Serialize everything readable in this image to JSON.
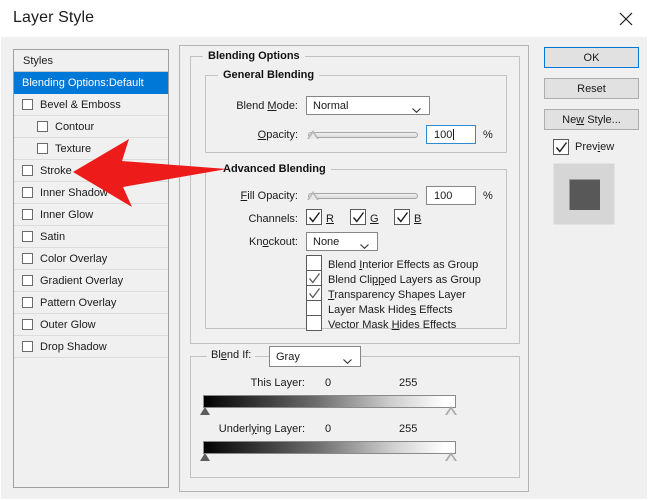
{
  "window": {
    "title": "Layer Style",
    "close_icon": "close-icon"
  },
  "styles_panel": {
    "header": "Styles",
    "items": [
      {
        "label": "Blending Options:Default",
        "selected": true,
        "checkbox": false,
        "indent": 0
      },
      {
        "label": "Bevel & Emboss",
        "selected": false,
        "checkbox": true,
        "checked": false,
        "indent": 0
      },
      {
        "label": "Contour",
        "selected": false,
        "checkbox": true,
        "checked": false,
        "indent": 1
      },
      {
        "label": "Texture",
        "selected": false,
        "checkbox": true,
        "checked": false,
        "indent": 1
      },
      {
        "label": "Stroke",
        "selected": false,
        "checkbox": true,
        "checked": false,
        "indent": 0
      },
      {
        "label": "Inner Shadow",
        "selected": false,
        "checkbox": true,
        "checked": false,
        "indent": 0
      },
      {
        "label": "Inner Glow",
        "selected": false,
        "checkbox": true,
        "checked": false,
        "indent": 0
      },
      {
        "label": "Satin",
        "selected": false,
        "checkbox": true,
        "checked": false,
        "indent": 0
      },
      {
        "label": "Color Overlay",
        "selected": false,
        "checkbox": true,
        "checked": false,
        "indent": 0
      },
      {
        "label": "Gradient Overlay",
        "selected": false,
        "checkbox": true,
        "checked": false,
        "indent": 0
      },
      {
        "label": "Pattern Overlay",
        "selected": false,
        "checkbox": true,
        "checked": false,
        "indent": 0
      },
      {
        "label": "Outer Glow",
        "selected": false,
        "checkbox": true,
        "checked": false,
        "indent": 0
      },
      {
        "label": "Drop Shadow",
        "selected": false,
        "checkbox": true,
        "checked": false,
        "indent": 0
      }
    ]
  },
  "blending_options": {
    "legend": "Blending Options",
    "general": {
      "legend": "General Blending",
      "blend_mode_label": "Blend Mode:",
      "blend_mode_value": "Normal",
      "opacity_label": "Opacity:",
      "opacity_value": "100",
      "opacity_unit": "%"
    },
    "advanced": {
      "legend": "Advanced Blending",
      "fill_opacity_label": "Fill Opacity:",
      "fill_opacity_value": "100",
      "fill_opacity_unit": "%",
      "channels_label": "Channels:",
      "channels": [
        {
          "letter": "R",
          "checked": true
        },
        {
          "letter": "G",
          "checked": true
        },
        {
          "letter": "B",
          "checked": true
        }
      ],
      "knockout_label": "Knockout:",
      "knockout_value": "None",
      "options": [
        {
          "label": "Blend Interior Effects as Group",
          "checked": false
        },
        {
          "label": "Blend Clipped Layers as Group",
          "checked": true
        },
        {
          "label": "Transparency Shapes Layer",
          "checked": true
        },
        {
          "label": "Layer Mask Hides Effects",
          "checked": false
        },
        {
          "label": "Vector Mask Hides Effects",
          "checked": false
        }
      ]
    },
    "blend_if": {
      "label": "Blend If:",
      "value": "Gray",
      "this_layer": {
        "label": "This Layer:",
        "min": "0",
        "max": "255"
      },
      "underlying_layer": {
        "label": "Underlying Layer:",
        "min": "0",
        "max": "255"
      }
    }
  },
  "buttons": {
    "ok": "OK",
    "reset": "Reset",
    "new_style": "New Style...",
    "preview_label": "Preview",
    "preview_checked": true
  },
  "annotation": {
    "type": "red-arrow",
    "points_to": "Stroke",
    "color": "#ee1b1b"
  },
  "colors": {
    "accent": "#0078d7",
    "dialog_bg": "#f0f0f0",
    "selection": "#0078d7",
    "arrow_red": "#ee1b1b",
    "thumbnail_fill": "#585858"
  }
}
